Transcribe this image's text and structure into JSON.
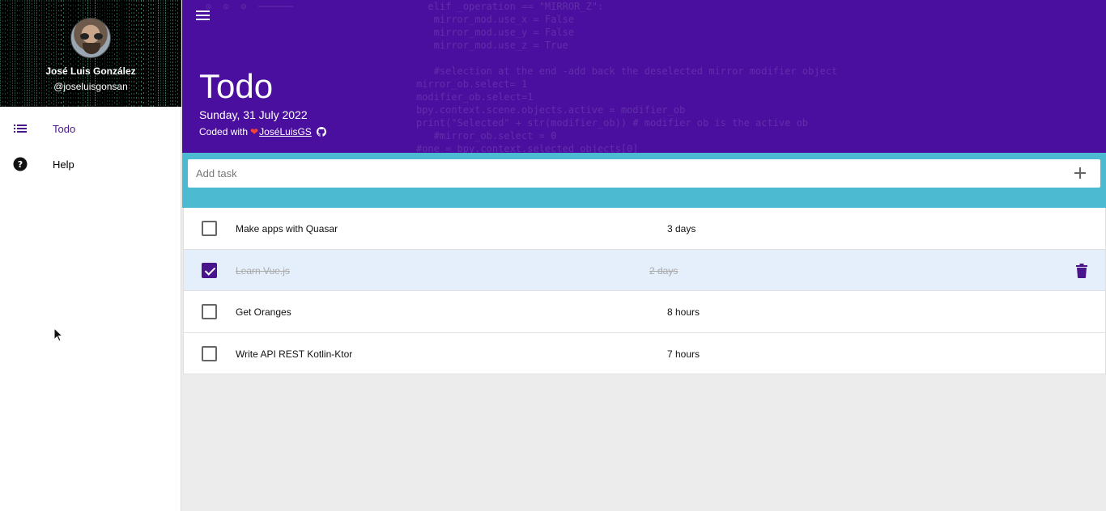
{
  "drawer": {
    "user_name": "José Luis González",
    "user_handle": "@joseluisgonsan",
    "nav": [
      {
        "label": "Todo",
        "icon": "list-icon",
        "active": true
      },
      {
        "label": "Help",
        "icon": "help-circle-icon",
        "active": false
      }
    ]
  },
  "header": {
    "title": "Todo",
    "date": "Sunday, 31 July 2022",
    "coded_with_prefix": "Coded with",
    "heart": "❤",
    "author": "JoséLuisGS",
    "github_icon": "github-icon"
  },
  "add_task": {
    "placeholder": "Add task",
    "add_icon": "plus-icon"
  },
  "tasks": [
    {
      "name": "Make apps with Quasar",
      "due": "3 days",
      "done": false
    },
    {
      "name": "Learn Vue.js",
      "due": "2 days",
      "done": true
    },
    {
      "name": "Get Oranges",
      "due": "8 hours",
      "done": false
    },
    {
      "name": "Write API REST Kotlin-Ktor",
      "due": "7 hours",
      "done": false
    }
  ],
  "colors": {
    "accent": "#4a148c",
    "header_bg": "#4a0f9e",
    "addbar_bg": "#4cbad1",
    "done_row_bg": "#e4effb",
    "heart": "#f44336"
  }
}
